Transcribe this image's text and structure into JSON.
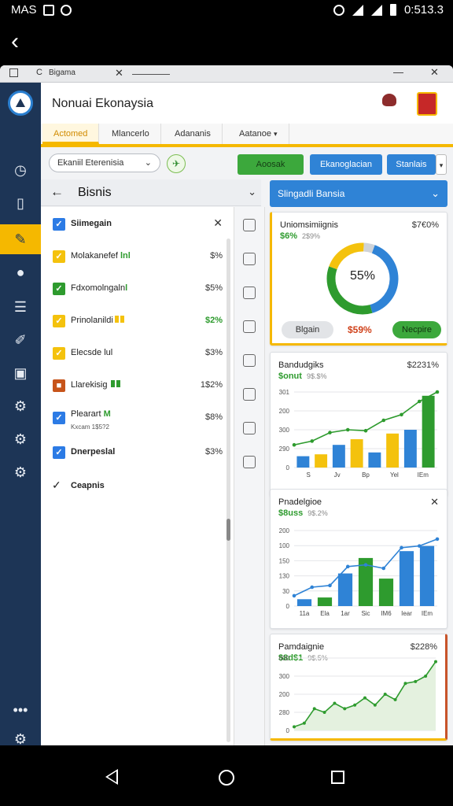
{
  "status_bar": {
    "carrier": "MAS",
    "time": "0:513.3"
  },
  "window": {
    "tab_title": "Bigama",
    "tab_letter": "C"
  },
  "header": {
    "title": "Nonuai Ekonaysia"
  },
  "tabs": [
    {
      "label": "Actomed"
    },
    {
      "label": "Mlancerlo"
    },
    {
      "label": "Adananis"
    },
    {
      "label": "Aatanoe"
    }
  ],
  "toolbar": {
    "select_value": "Ekaniil Eterenisia",
    "btn_green": "Aoosak",
    "btn_blue1": "Ekanoglacian",
    "btn_blue2": "Stanlais"
  },
  "panel": {
    "title": "Bisnis",
    "items": [
      {
        "label": "Siimegain",
        "value": "",
        "checkbox": "blue",
        "close": "✕"
      },
      {
        "label": "Molakanefef",
        "tag": "lnl",
        "value": "$%",
        "checkbox": "yellow"
      },
      {
        "label": "Fdxomolngaln",
        "tag": "l",
        "value": "$5%",
        "checkbox": "green"
      },
      {
        "label": "Prinolanildi",
        "value": "$2%",
        "checkbox": "yellow"
      },
      {
        "label": "Elecsde",
        "tag": "lul",
        "value": "$3%",
        "checkbox": "yellow"
      },
      {
        "label": "Llarekisig",
        "value": "1$2%",
        "checkbox": "orange"
      },
      {
        "label": "Plearart",
        "tag": "M",
        "sub": "Kxcam 1$5?2",
        "value": "$8%",
        "checkbox": "blue"
      },
      {
        "label": "Dnerpeslal",
        "value": "$3%",
        "checkbox": "blue"
      }
    ],
    "footer_item": "Ceapnis"
  },
  "right": {
    "bar_title": "Slingadli Bansia",
    "card1": {
      "title": "Uniomsimiignis",
      "amount": "$7€0%",
      "stat": "$6%",
      "stat_muted": "2$9%",
      "donut_label": "55%",
      "donut_segments": [
        {
          "value": 40,
          "color": "#2f83d6"
        },
        {
          "value": 35,
          "color": "#2e9b2e"
        },
        {
          "value": 20,
          "color": "#f4c20d"
        },
        {
          "value": 5,
          "color": "#cfd3d8"
        }
      ],
      "pill_left": "Blgain",
      "red_value": "$59%",
      "pill_right": "Necpire"
    },
    "card2": {
      "title": "Bandudgiks",
      "amount": "$2231%",
      "stat": "$onut",
      "stat_muted": "9$.$%"
    },
    "card3": {
      "title": "Pnadelgioe",
      "stat": "$8uss",
      "stat_muted": "9$.2%",
      "close": "✕"
    },
    "card4": {
      "title": "Pamdaignie",
      "amount": "$228%",
      "stat": "$8d$1",
      "stat_muted": "9$.5%"
    }
  },
  "chart_data": [
    {
      "type": "bar",
      "title": "Bandudgiks",
      "categories": [
        "S",
        "Jv",
        "Bp",
        "Yel",
        "IEm"
      ],
      "yticks": [
        "0",
        "290",
        "300",
        "200",
        "301"
      ],
      "ylim": [
        0,
        400
      ],
      "series": [
        {
          "values": [
            60,
            70,
            120,
            150,
            80,
            180,
            200,
            380
          ],
          "colors": [
            "#2f83d6",
            "#f4c20d",
            "#2f83d6",
            "#f4c20d",
            "#2f83d6",
            "#f4c20d",
            "#2f83d6",
            "#2e9b2e"
          ]
        }
      ],
      "line": [
        120,
        140,
        185,
        200,
        195,
        250,
        280,
        350,
        400
      ]
    },
    {
      "type": "bar",
      "title": "Pnadelgioe",
      "categories": [
        "11a",
        "Ela",
        "1ar",
        "Sic",
        "IM6",
        "Iear",
        "IEm"
      ],
      "yticks": [
        "0",
        "30",
        "130",
        "150",
        "100",
        "200"
      ],
      "ylim": [
        0,
        220
      ],
      "series": [
        {
          "values": [
            20,
            25,
            95,
            140,
            80,
            160,
            175
          ],
          "colors": [
            "#2f83d6",
            "#2e9b2e",
            "#2f83d6",
            "#2e9b2e",
            "#2e9b2e",
            "#2f83d6",
            "#2f83d6"
          ]
        }
      ],
      "line": [
        30,
        55,
        60,
        115,
        120,
        110,
        170,
        175,
        195
      ]
    },
    {
      "type": "area",
      "title": "Pamdaignie",
      "yticks": [
        "0",
        "280",
        "200",
        "300",
        "000"
      ],
      "ylim": [
        0,
        400
      ],
      "series": [
        {
          "values": [
            20,
            40,
            120,
            100,
            150,
            120,
            140,
            180,
            140,
            200,
            170,
            260,
            270,
            300,
            380
          ]
        }
      ]
    }
  ]
}
